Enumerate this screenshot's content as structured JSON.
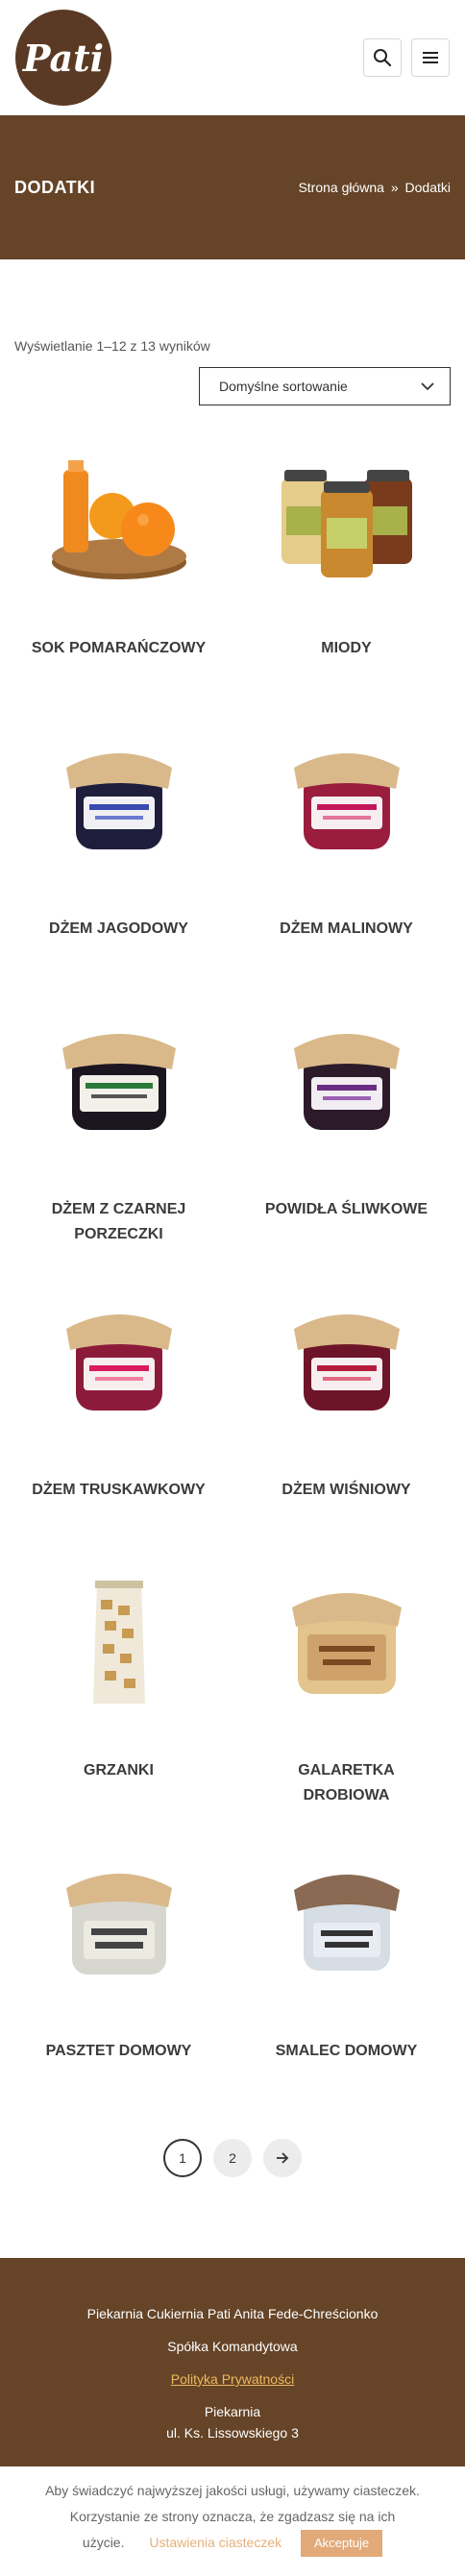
{
  "header": {
    "logo_text": "Pati",
    "search_icon": "search-icon",
    "menu_icon": "hamburger-menu-icon"
  },
  "banner": {
    "title": "DODATKI",
    "breadcrumb_home": "Strona główna",
    "breadcrumb_sep": "»",
    "breadcrumb_current": "Dodatki"
  },
  "results": {
    "count_text": "Wyświetlanie 1–12 z 13 wyników",
    "sort_label": "Domyślne sortowanie"
  },
  "products": [
    {
      "title": "SOK POMARAŃCZOWY",
      "image": "orange-juice"
    },
    {
      "title": "MIODY",
      "image": "honey-jars"
    },
    {
      "title": "DŻEM JAGODOWY",
      "image": "jar-blue"
    },
    {
      "title": "DŻEM MALINOWY",
      "image": "jar-raspberry"
    },
    {
      "title": "DŻEM Z CZARNEJ PORZECZKI",
      "image": "jar-dark"
    },
    {
      "title": "POWIDŁA ŚLIWKOWE",
      "image": "jar-plum"
    },
    {
      "title": "DŻEM TRUSKAWKOWY",
      "image": "jar-strawberry"
    },
    {
      "title": "DŻEM WIŚNIOWY",
      "image": "jar-cherry"
    },
    {
      "title": "GRZANKI",
      "image": "croutons-bag"
    },
    {
      "title": "GALARETKA DROBIOWA",
      "image": "jar-jelly"
    },
    {
      "title": "PASZTET DOMOWY",
      "image": "jar-pate"
    },
    {
      "title": "SMALEC DOMOWY",
      "image": "jar-lard"
    }
  ],
  "pagination": {
    "page1": "1",
    "page2": "2",
    "next_icon": "arrow-right-icon"
  },
  "footer": {
    "line1": "Piekarnia Cukiernia Pati Anita Fede-Chreścionko",
    "line2": "Spółka Komandytowa",
    "policy": "Polityka Prywatności",
    "line3": "Piekarnia",
    "line4": "ul. Ks. Lissowskiego 3"
  },
  "cookie": {
    "text1": "Aby świadczyć najwyższej jakości usługi, używamy ciasteczek.",
    "text2": "Korzystanie ze strony oznacza, że zgadzasz się na ich",
    "text3": "użycie.",
    "settings": "Ustawienia ciasteczek",
    "accept": "Akceptuje"
  },
  "colors": {
    "brand_brown": "#654427",
    "accept_button": "#e2a979",
    "policy_link": "#f0b860"
  }
}
